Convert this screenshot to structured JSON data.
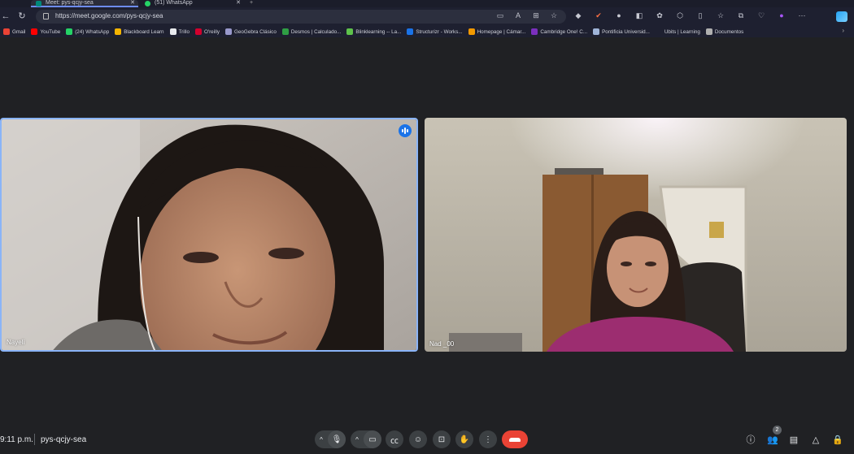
{
  "browser": {
    "tabs": [
      {
        "title": "Meet: pys-qcjy-sea",
        "active": true
      },
      {
        "title": "(51) WhatsApp",
        "active": false
      }
    ],
    "url": "https://meet.google.com/pys-qcjy-sea",
    "bookmarks": [
      {
        "label": "Gmail",
        "color": "#ea4335"
      },
      {
        "label": "YouTube",
        "color": "#ff0000"
      },
      {
        "label": "(24) WhatsApp",
        "color": "#25d366"
      },
      {
        "label": "Blackboard Learn",
        "color": "#f4b400"
      },
      {
        "label": "Trillo",
        "color": "#e8eaed"
      },
      {
        "label": "O'reilly",
        "color": "#d3002d"
      },
      {
        "label": "GeoGebra Clásico",
        "color": "#99c"
      },
      {
        "label": "Desmos | Calculado...",
        "color": "#2f9e44"
      },
      {
        "label": "Blinklearning -- La...",
        "color": "#5ec24b"
      },
      {
        "label": "Structurizr - Works...",
        "color": "#1a73e8"
      },
      {
        "label": "Homepage | Cámar...",
        "color": "#f29900"
      },
      {
        "label": "Cambridge One! C...",
        "color": "#7b2fbe"
      },
      {
        "label": "Pontificia Universid...",
        "color": "#9fb4d8"
      },
      {
        "label": "Ubits | Learning",
        "color": "#1e2030"
      },
      {
        "label": "Documentos",
        "color": "#b0b0b0"
      }
    ]
  },
  "meeting": {
    "time": "9:11 p.m.",
    "code": "pys-qcjy-sea",
    "participant_count": "2",
    "participants": [
      {
        "name": "Nayeli",
        "speaking": true
      },
      {
        "name": "Nad _00",
        "speaking": false
      }
    ]
  },
  "colors": {
    "background": "#202124",
    "active_border": "#8ab4f8",
    "end_call": "#ea4335",
    "control_bg": "#3c4043"
  }
}
